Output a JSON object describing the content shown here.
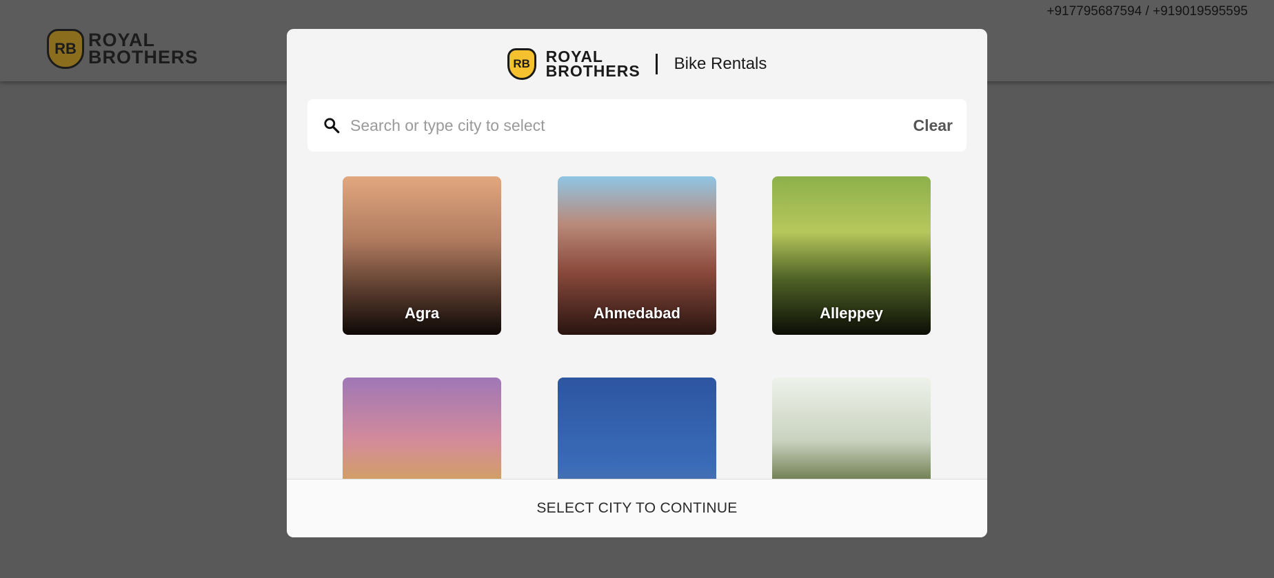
{
  "background": {
    "phone": "+917795687594 / +919019595595",
    "logo": {
      "badge": "RB",
      "line1": "ROYAL",
      "line2": "BROTHERS"
    }
  },
  "modal": {
    "logo": {
      "badge": "RB",
      "line1": "ROYAL",
      "line2": "BROTHERS",
      "tagline": "Bike Rentals"
    },
    "search": {
      "placeholder": "Search or type city to select",
      "value": "",
      "clear_label": "Clear"
    },
    "cities": [
      {
        "name": "Agra"
      },
      {
        "name": "Ahmedabad"
      },
      {
        "name": "Alleppey"
      },
      {
        "name": ""
      },
      {
        "name": ""
      },
      {
        "name": ""
      }
    ],
    "footer_label": "SELECT CITY TO CONTINUE"
  },
  "colors": {
    "accent": "#f5c12e",
    "overlay": "#595959",
    "modal_bg": "#f4f4f4"
  }
}
